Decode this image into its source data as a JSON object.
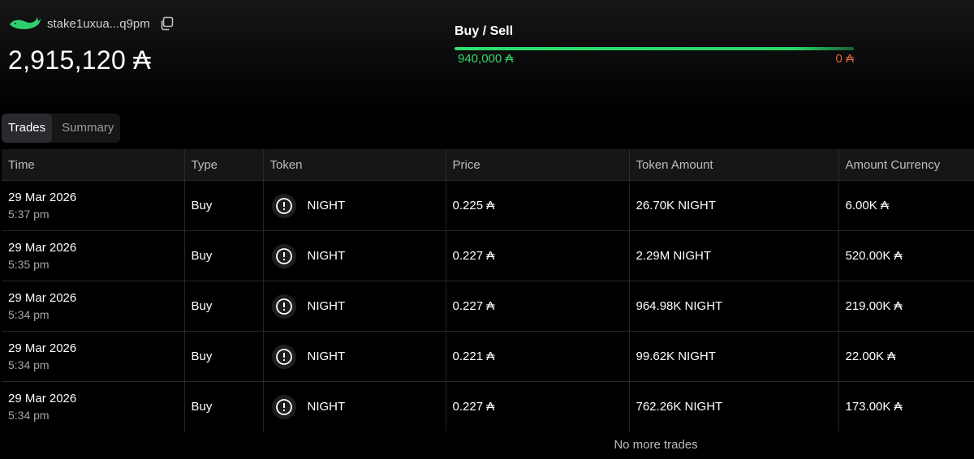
{
  "header": {
    "wallet_address": "stake1uxua...q9pm",
    "balance": "2,915,120 ₳"
  },
  "buy_sell": {
    "title": "Buy / Sell",
    "buy_value": "940,000 ₳",
    "sell_value": "0 ₳",
    "buy_fraction": 1.0,
    "buy_color": "#35d86a",
    "sell_color": "#e0613f"
  },
  "tabs": [
    {
      "label": "Trades",
      "active": true
    },
    {
      "label": "Summary",
      "active": false
    }
  ],
  "table": {
    "columns": [
      "Time",
      "Type",
      "Token",
      "Price",
      "Token Amount",
      "Amount Currency"
    ],
    "rows": [
      {
        "date": "29 Mar 2026",
        "time": "5:37 pm",
        "type": "Buy",
        "token": "NIGHT",
        "price": "0.225 ₳",
        "token_amount": "26.70K NIGHT",
        "amount_currency": "6.00K ₳"
      },
      {
        "date": "29 Mar 2026",
        "time": "5:35 pm",
        "type": "Buy",
        "token": "NIGHT",
        "price": "0.227 ₳",
        "token_amount": "2.29M NIGHT",
        "amount_currency": "520.00K ₳"
      },
      {
        "date": "29 Mar 2026",
        "time": "5:34 pm",
        "type": "Buy",
        "token": "NIGHT",
        "price": "0.227 ₳",
        "token_amount": "964.98K NIGHT",
        "amount_currency": "219.00K ₳"
      },
      {
        "date": "29 Mar 2026",
        "time": "5:34 pm",
        "type": "Buy",
        "token": "NIGHT",
        "price": "0.221 ₳",
        "token_amount": "99.62K NIGHT",
        "amount_currency": "22.00K ₳"
      },
      {
        "date": "29 Mar 2026",
        "time": "5:34 pm",
        "type": "Buy",
        "token": "NIGHT",
        "price": "0.227 ₳",
        "token_amount": "762.26K NIGHT",
        "amount_currency": "173.00K ₳"
      }
    ],
    "footer": "No more trades"
  },
  "icons": {
    "wallet": "whale-icon",
    "copy": "copy-icon",
    "token": "night-token-icon"
  }
}
